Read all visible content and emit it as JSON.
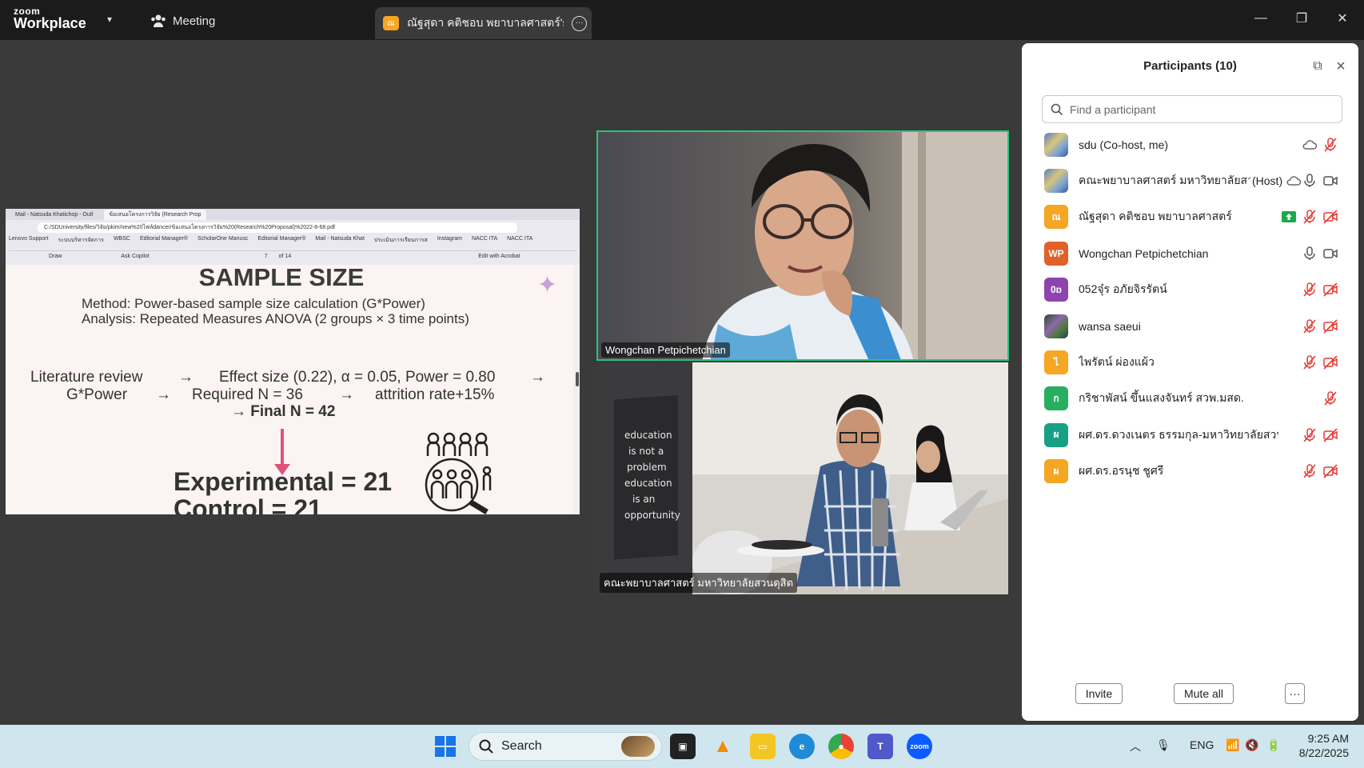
{
  "app": {
    "brand_top": "zoom",
    "brand_bottom": "Workplace",
    "meeting_label": "Meeting",
    "share_badge": "ณ",
    "share_tab_label": "ณัฐสุดา คติชอบ พยาบาลศาสตร์'s scre"
  },
  "shared_screen": {
    "browser_tabs": [
      "Mail - Natsuda Khatichop - Outl",
      "ข้อเสนอโครงการวิจัย (Research Prop"
    ],
    "address": "C:/SDUniversity/files/วิจัย/pkim/new%20ไฟล์dancer/ข้อเสนอโครงการวิจัย%20(Research%20Proposal)%2022-8-68.pdf",
    "bookmarks": [
      "Lenovo Support",
      "ระบบบริหารจัดการ",
      "WBSC",
      "Editorial Manager®",
      "ScholarOne Manusc",
      "Editorial Manager®",
      "Mail - Natsuda Khat",
      "ประเมินการเรียนการส",
      "Instagram",
      "NACC ITA",
      "NACC ITA"
    ],
    "pdf_tools": [
      "Draw",
      "Ask Copilot",
      "7",
      "of 14",
      "Edit with Acrobat"
    ],
    "slide": {
      "title": "SAMPLE SIZE",
      "method": "Method: Power-based sample size calculation (G*Power)",
      "analysis": "Analysis: Repeated Measures ANOVA (2 groups × 3 time points)",
      "flow1_a": "Literature review",
      "flow1_b": "Effect size (0.22), α = 0.05, Power = 0.80",
      "flow2_a": "G*Power",
      "flow2_b": "Required N = 36",
      "flow2_c": "attrition rate+15%",
      "arrow": "→",
      "final_n": "→ Final N = 42",
      "experimental": "Experimental = 21",
      "control": "Control           = 21"
    }
  },
  "videos": [
    {
      "name": "Wongchan Petpichetchian"
    },
    {
      "name": "คณะพยาบาลศาสตร์ มหาวิทยาลัยสวนดุสิต"
    }
  ],
  "panel": {
    "title": "Participants (10)",
    "search_placeholder": "Find a participant",
    "participants": [
      {
        "name": "sdu (Co-host, me)",
        "tag": "",
        "avatar": "",
        "avatar_color": "",
        "icons": [
          "cloud-icon",
          "mic-muted-icon"
        ]
      },
      {
        "name": "คณะพยาบาลศาสตร์ มหาวิทยาลัยสวน...",
        "tag": "(Host)",
        "avatar": "",
        "avatar_color": "",
        "icons": [
          "cloud-icon",
          "mic-icon",
          "video-icon"
        ]
      },
      {
        "name": "ณัฐสุดา คติชอบ พยาบาลศาสตร์",
        "tag": "",
        "avatar": "ณ",
        "avatar_color": "#f5a623",
        "icons": [
          "share-screen-icon",
          "mic-muted-icon",
          "video-off-icon"
        ]
      },
      {
        "name": "Wongchan Petpichetchian",
        "tag": "",
        "avatar": "WP",
        "avatar_color": "#e0602a",
        "icons": [
          "mic-icon",
          "video-icon"
        ]
      },
      {
        "name": "052จุ๋ร อภัยจิรรัตน์",
        "tag": "",
        "avatar": "0ɒ",
        "avatar_color": "#8e44ad",
        "icons": [
          "mic-muted-icon",
          "video-off-icon"
        ]
      },
      {
        "name": "wansa saeui",
        "tag": "",
        "avatar": "",
        "avatar_color": "",
        "icons": [
          "mic-muted-icon",
          "video-off-icon"
        ]
      },
      {
        "name": "ไพรัตน์ ผ่องแผ้ว",
        "tag": "",
        "avatar": "ไ",
        "avatar_color": "#f5a623",
        "icons": [
          "mic-muted-icon",
          "video-off-icon"
        ]
      },
      {
        "name": "กริชาพัสน์ ขึ้นแสงจันทร์ สวพ.มสด.",
        "tag": "",
        "avatar": "ก",
        "avatar_color": "#27ae60",
        "icons": [
          "mic-muted-icon"
        ]
      },
      {
        "name": "ผศ.ดร.ดวงเนตร ธรรมกุล-มหาวิทยาลัยสวนดุสิต",
        "tag": "",
        "avatar": "ผ",
        "avatar_color": "#16a085",
        "icons": [
          "mic-muted-icon",
          "video-off-icon"
        ]
      },
      {
        "name": "ผศ.ดร.อรนุช ชูศรี",
        "tag": "",
        "avatar": "ผ",
        "avatar_color": "#f5a623",
        "icons": [
          "mic-muted-icon",
          "video-off-icon"
        ]
      }
    ],
    "invite_label": "Invite",
    "mute_all_label": "Mute all",
    "more_label": "···"
  },
  "taskbar": {
    "search_label": "Search",
    "language": "ENG",
    "time": "9:25 AM",
    "date": "8/22/2025",
    "zoom_app": "zoom"
  },
  "colors": {
    "active_speaker": "#2ac57a",
    "muted_red": "#e53935",
    "accent_blue": "#0b5cff"
  }
}
